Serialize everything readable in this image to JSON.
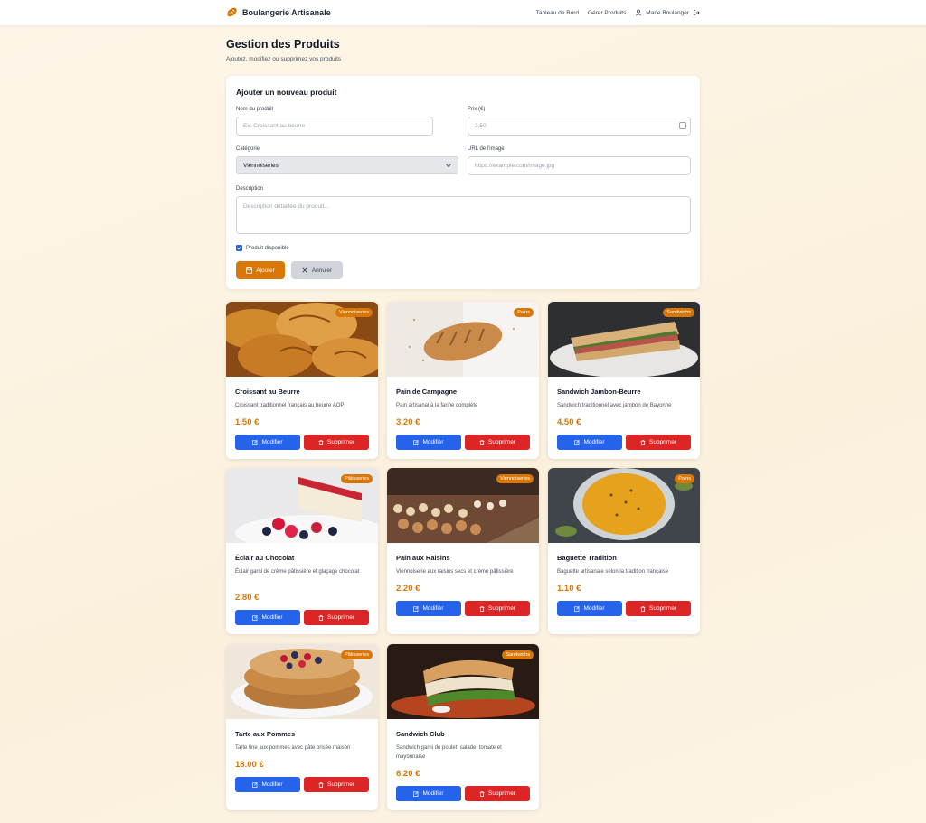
{
  "nav": {
    "brand": "Boulangerie Artisanale",
    "links": [
      "Tableau de Bord",
      "Gérer Produits"
    ],
    "user": "Marie Boulanger"
  },
  "header": {
    "title": "Gestion des Produits",
    "subtitle": "Ajoutez, modifiez ou supprimez vos produits"
  },
  "form": {
    "title": "Ajouter un nouveau produit",
    "name_label": "Nom du produit",
    "name_placeholder": "Ex: Croissant au beurre",
    "price_label": "Prix (€)",
    "price_placeholder": "2.50",
    "category_label": "Catégorie",
    "category_value": "Viennoiseries",
    "image_label": "URL de l'image",
    "image_placeholder": "https://example.com/image.jpg",
    "description_label": "Description",
    "description_placeholder": "Description détaillée du produit...",
    "available_label": "Produit disponible",
    "available_checked": true,
    "add_label": "Ajouter",
    "cancel_label": "Annuler"
  },
  "colors": {
    "accent": "#d97706",
    "edit": "#2563eb",
    "delete": "#dc2626"
  },
  "actions": {
    "edit": "Modifier",
    "delete": "Supprimer"
  },
  "products": [
    {
      "name": "Croissant au Beurre",
      "description": "Croissant traditionnel français au beurre AOP",
      "price": "1.50 €",
      "category": "Viennoiseries",
      "image": "croissants"
    },
    {
      "name": "Pain de Campagne",
      "description": "Pain artisanal à la farine complète",
      "price": "3.20 €",
      "category": "Pains",
      "image": "bread-loaf"
    },
    {
      "name": "Sandwich Jambon-Beurre",
      "description": "Sandwich traditionnel avec jambon de Bayonne",
      "price": "4.50 €",
      "category": "Sandwichs",
      "image": "sandwich"
    },
    {
      "name": "Éclair au Chocolat",
      "description": "Éclair garni de crème pâtissière et glaçage chocolat",
      "price": "2.80 €",
      "category": "Pâtisseries",
      "image": "cheesecake"
    },
    {
      "name": "Pain aux Raisins",
      "description": "Viennoiserie aux raisins secs et crème pâtissière",
      "price": "2.20 €",
      "category": "Viennoiseries",
      "image": "pastry-display"
    },
    {
      "name": "Baguette Tradition",
      "description": "Baguette artisanale selon la tradition française",
      "price": "1.10 €",
      "category": "Pains",
      "image": "soup-bowl"
    },
    {
      "name": "Tarte aux Pommes",
      "description": "Tarte fine aux pommes avec pâte brisée maison",
      "price": "18.00 €",
      "category": "Pâtisseries",
      "image": "layer-cake"
    },
    {
      "name": "Sandwich Club",
      "description": "Sandwich garni de poulet, salade, tomate et mayonnaise",
      "price": "6.20 €",
      "category": "Sandwichs",
      "image": "club-sandwich"
    }
  ]
}
